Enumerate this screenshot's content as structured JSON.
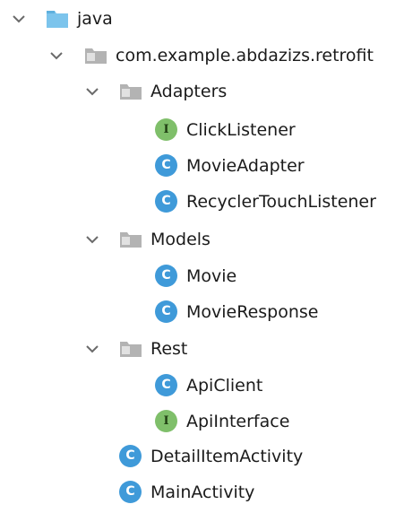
{
  "tree": {
    "root": {
      "label": "java",
      "icon": "source-folder-icon",
      "expanded": true
    },
    "package": {
      "label": "com.example.abdazizs.retrofit",
      "icon": "package-folder-icon",
      "expanded": true
    },
    "adapters": {
      "label": "Adapters",
      "icon": "package-folder-icon",
      "expanded": true,
      "items": [
        {
          "label": "ClickListener",
          "kind": "interface",
          "badge": "I"
        },
        {
          "label": "MovieAdapter",
          "kind": "class",
          "badge": "C"
        },
        {
          "label": "RecyclerTouchListener",
          "kind": "class",
          "badge": "C"
        }
      ]
    },
    "models": {
      "label": "Models",
      "icon": "package-folder-icon",
      "expanded": true,
      "items": [
        {
          "label": "Movie",
          "kind": "class",
          "badge": "C"
        },
        {
          "label": "MovieResponse",
          "kind": "class",
          "badge": "C"
        }
      ]
    },
    "rest": {
      "label": "Rest",
      "icon": "package-folder-icon",
      "expanded": true,
      "items": [
        {
          "label": "ApiClient",
          "kind": "class",
          "badge": "C"
        },
        {
          "label": "ApiInterface",
          "kind": "interface",
          "badge": "I"
        }
      ]
    },
    "files": [
      {
        "label": "DetailItemActivity",
        "kind": "class",
        "badge": "C"
      },
      {
        "label": "MainActivity",
        "kind": "class",
        "badge": "C"
      }
    ]
  },
  "colors": {
    "class_badge": "#3f9ad9",
    "interface_badge": "#7fbf6a",
    "source_folder": "#7cc4ec",
    "package_folder": "#a9a9a9",
    "chevron": "#6a6a6a"
  }
}
